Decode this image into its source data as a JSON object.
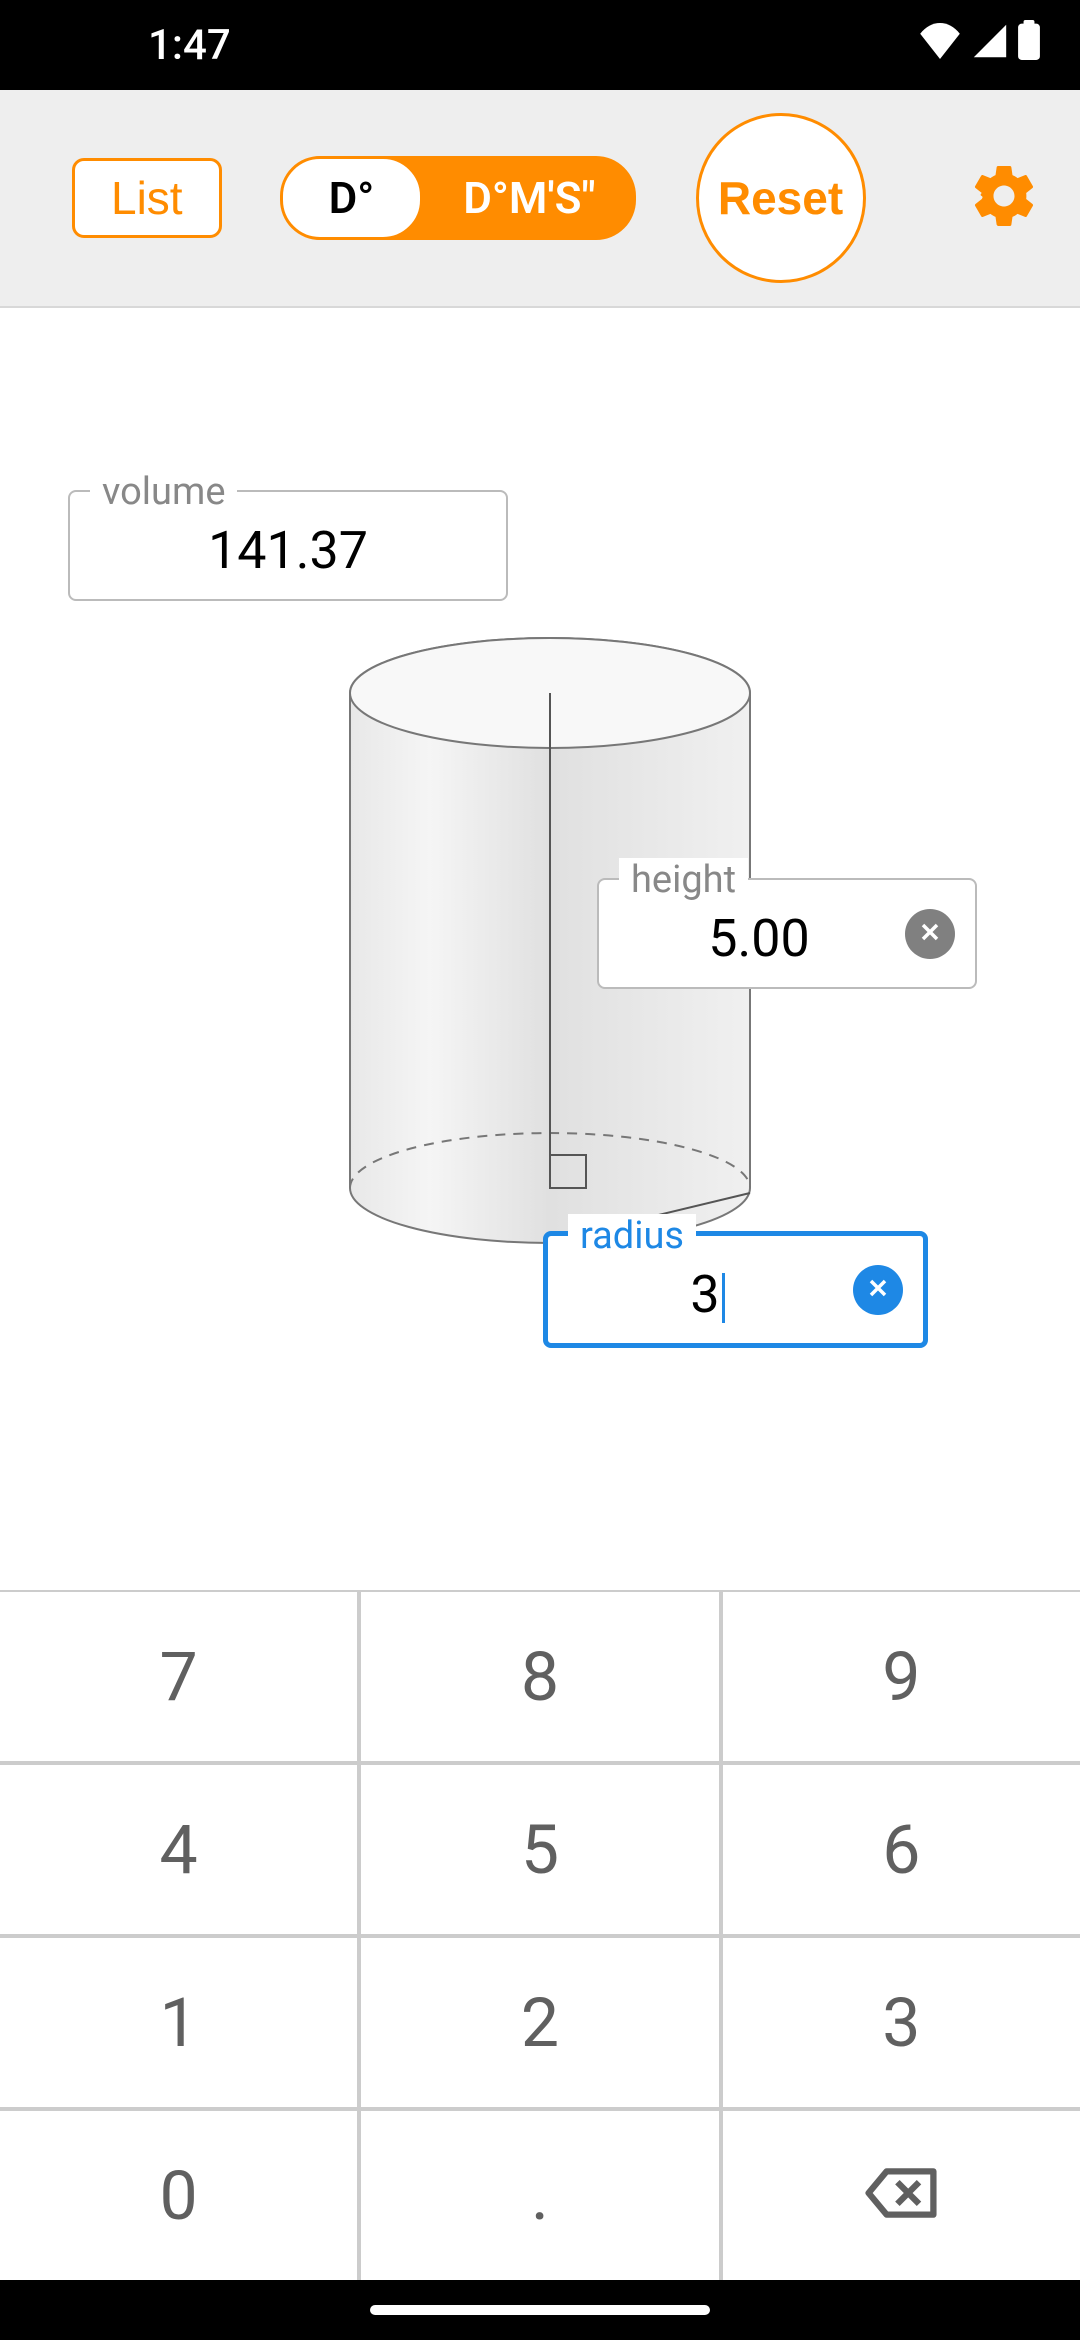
{
  "status": {
    "time": "1:47"
  },
  "toolbar": {
    "list_label": "List",
    "degree_mode_label": "D°",
    "dms_mode_label": "D°M'S\"",
    "reset_label": "Reset"
  },
  "fields": {
    "volume": {
      "label": "volume",
      "value": "141.37"
    },
    "height": {
      "label": "height",
      "value": "5.00"
    },
    "radius": {
      "label": "radius",
      "value": "3"
    }
  },
  "keypad": {
    "k7": "7",
    "k8": "8",
    "k9": "9",
    "k4": "4",
    "k5": "5",
    "k6": "6",
    "k1": "1",
    "k2": "2",
    "k3": "3",
    "k0": "0",
    "kdot": "."
  },
  "colors": {
    "accent": "#ff8c00",
    "focus": "#1e88e5"
  }
}
